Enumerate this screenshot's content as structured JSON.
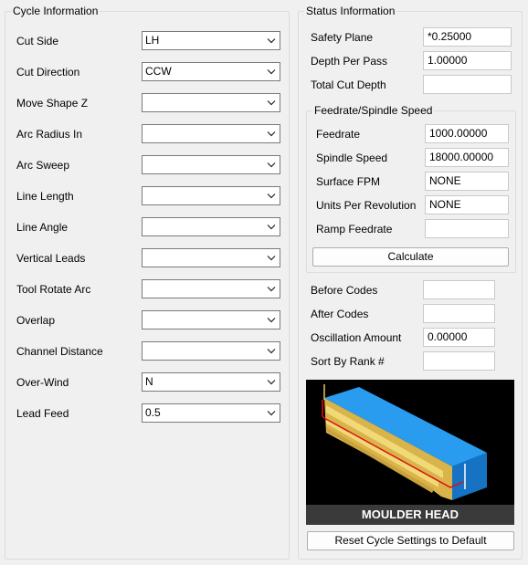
{
  "cycle": {
    "title": "Cycle Information",
    "rows": [
      {
        "label": "Cut Side",
        "value": "LH"
      },
      {
        "label": "Cut Direction",
        "value": "CCW"
      },
      {
        "label": "Move Shape Z",
        "value": ""
      },
      {
        "label": "Arc Radius In",
        "value": ""
      },
      {
        "label": "Arc Sweep",
        "value": ""
      },
      {
        "label": "Line Length",
        "value": ""
      },
      {
        "label": "Line Angle",
        "value": ""
      },
      {
        "label": "Vertical Leads",
        "value": ""
      },
      {
        "label": "Tool Rotate Arc",
        "value": ""
      },
      {
        "label": "Overlap",
        "value": ""
      },
      {
        "label": "Channel Distance",
        "value": ""
      },
      {
        "label": "Over-Wind",
        "value": "N"
      },
      {
        "label": "Lead Feed",
        "value": "0.5"
      }
    ]
  },
  "status": {
    "title": "Status Information",
    "rows": [
      {
        "label": "Safety Plane",
        "value": "*0.25000"
      },
      {
        "label": "Depth Per Pass",
        "value": "1.00000"
      },
      {
        "label": "Total Cut Depth",
        "value": ""
      }
    ]
  },
  "feed": {
    "title": "Feedrate/Spindle Speed",
    "rows": [
      {
        "label": "Feedrate",
        "value": "1000.00000"
      },
      {
        "label": "Spindle Speed",
        "value": "18000.00000"
      },
      {
        "label": "Surface FPM",
        "value": "NONE"
      },
      {
        "label": "Units Per Revolution",
        "value": "NONE"
      },
      {
        "label": "Ramp Feedrate",
        "value": ""
      }
    ],
    "calculate_label": "Calculate"
  },
  "extra": {
    "rows": [
      {
        "label": "Before Codes",
        "value": ""
      },
      {
        "label": "After Codes",
        "value": ""
      },
      {
        "label": "Oscillation Amount",
        "value": "0.00000"
      },
      {
        "label": "Sort By Rank #",
        "value": ""
      }
    ]
  },
  "preview": {
    "caption": "MOULDER HEAD",
    "colors": {
      "block": "#1f8fe0",
      "profile": "#e8c860",
      "path": "#e01010"
    }
  },
  "reset_label": "Reset Cycle Settings to Default"
}
